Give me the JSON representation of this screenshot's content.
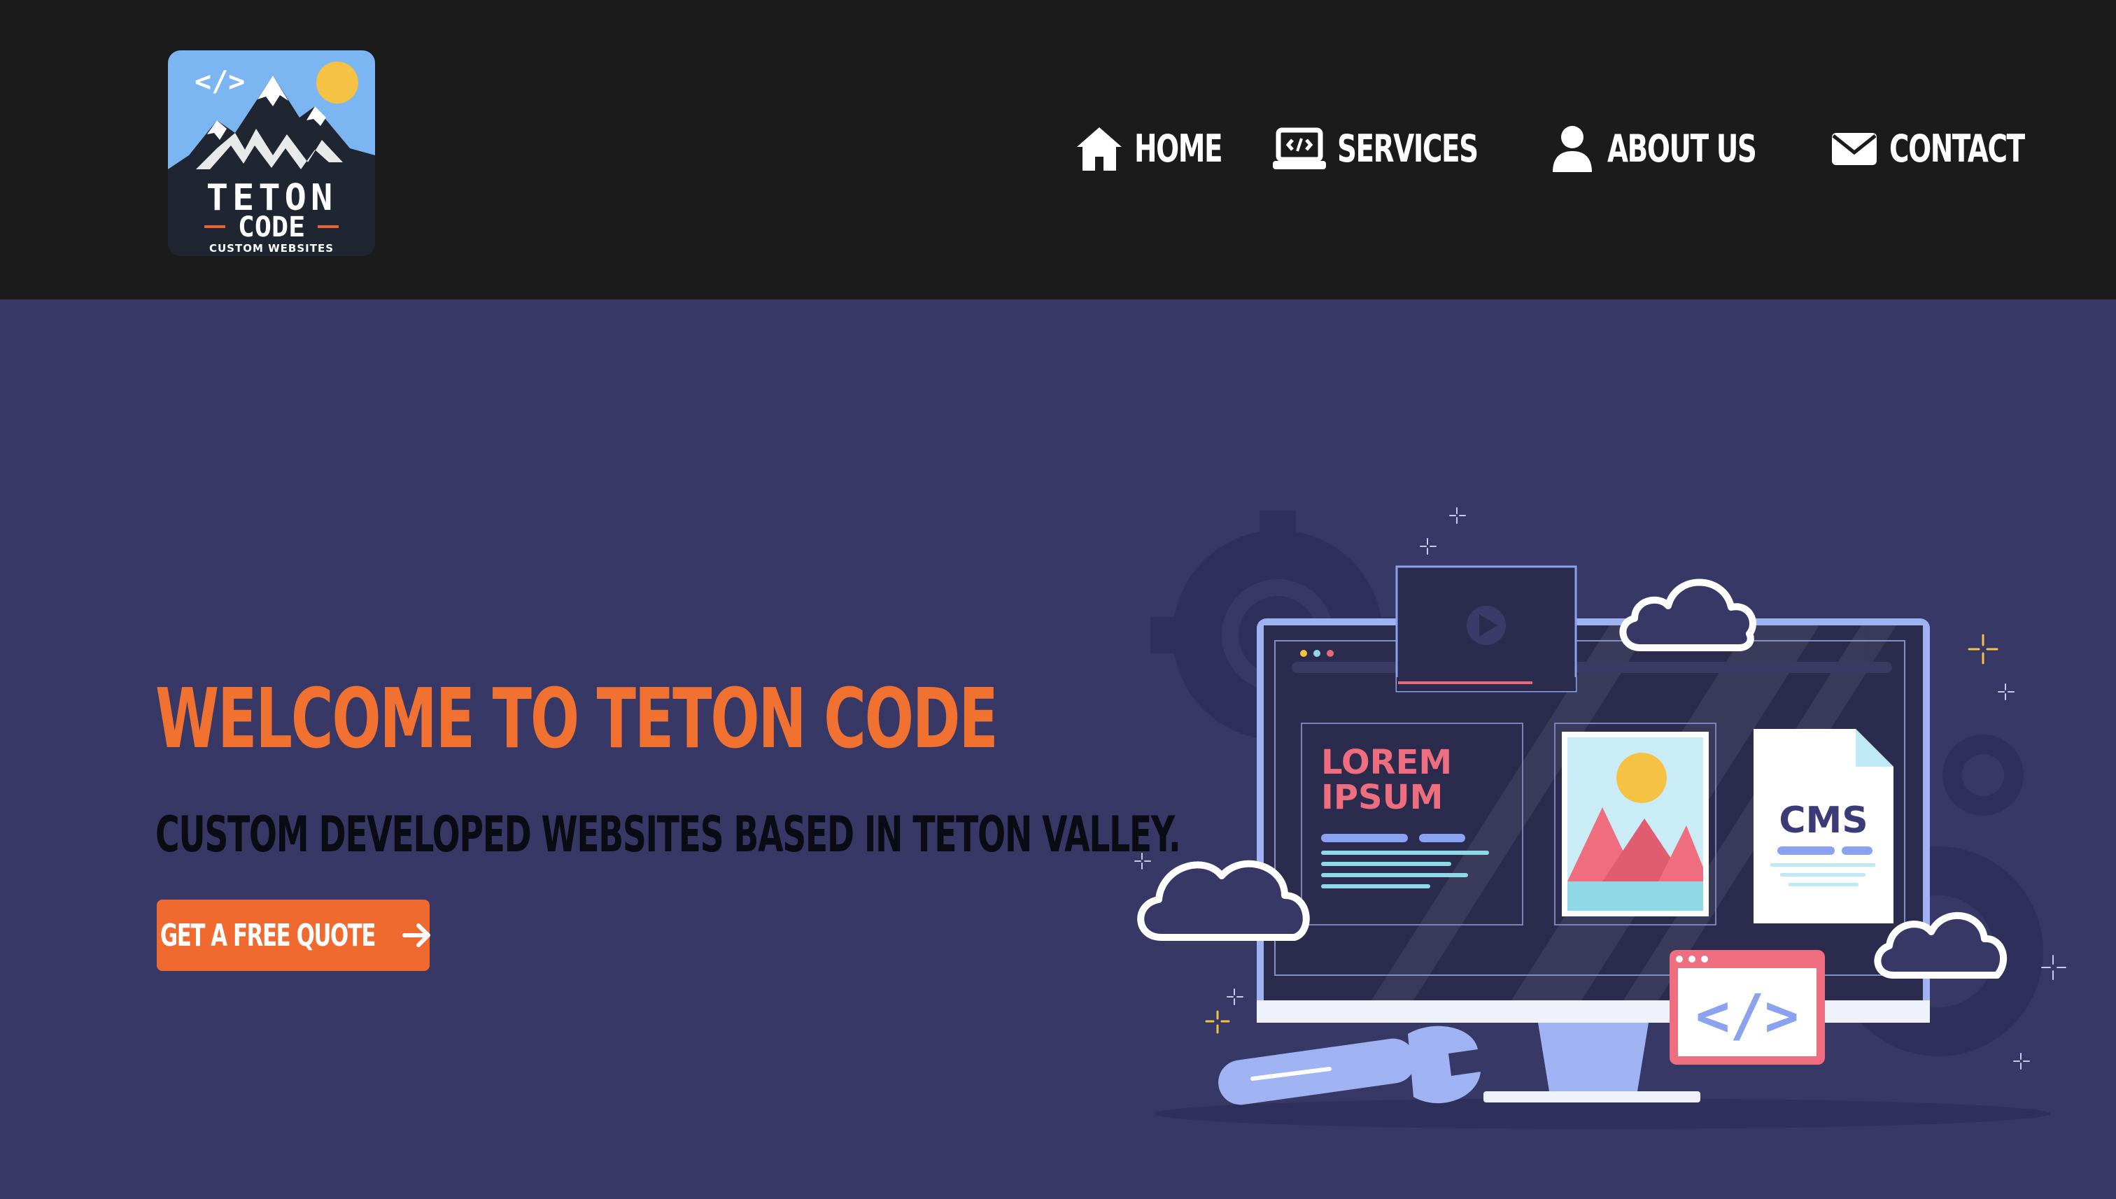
{
  "brand": {
    "logo_code_glyph": "</>",
    "logo_name_line1": "TETON",
    "logo_name_line2": "CODE",
    "logo_tagline": "CUSTOM WEBSITES"
  },
  "nav": {
    "items": [
      {
        "label": "HOME",
        "icon": "home-icon"
      },
      {
        "label": "SERVICES",
        "icon": "laptop-code-icon"
      },
      {
        "label": "ABOUT US",
        "icon": "user-icon"
      },
      {
        "label": "CONTACT",
        "icon": "envelope-icon"
      }
    ]
  },
  "hero": {
    "title": "WELCOME TO TETON CODE",
    "subtitle": "CUSTOM DEVELOPED WEBSITES BASED IN TETON VALLEY.",
    "cta_label": "GET A FREE QUOTE",
    "cta_icon": "arrow-right-icon"
  },
  "illustration": {
    "card_text_line1": "LOREM",
    "card_text_line2": "IPSUM",
    "doc_label": "CMS",
    "badge_code": "</>"
  },
  "colors": {
    "header_bg": "#1b1b1b",
    "page_bg": "#383867",
    "accent_orange": "#f07130",
    "nav_text": "#ffffff"
  }
}
